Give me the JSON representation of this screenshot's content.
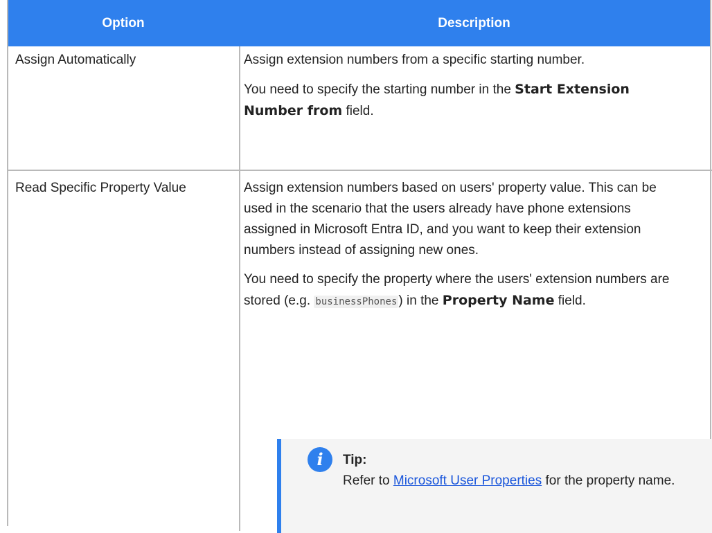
{
  "table": {
    "headers": {
      "option": "Option",
      "description": "Description"
    },
    "rows": [
      {
        "option": "Assign Automatically",
        "description": {
          "p1": "Assign extension numbers from a specific starting number.",
          "p2_before": "You need to specify the starting number in the ",
          "p2_bold": "Start Extension Number from",
          "p2_after": " field."
        }
      },
      {
        "option": "Read Specific Property Value",
        "description": {
          "p1": "Assign extension numbers based on users' property value. This can be used in the scenario that the users already have phone extensions assigned in Microsoft Entra ID, and you want to keep their extension numbers instead of assigning new ones.",
          "p2_before": "You need to specify the property where the users' extension numbers are stored (e.g. ",
          "p2_code": "businessPhones",
          "p2_middle": ") in the ",
          "p2_bold": "Property Name",
          "p2_after": " field."
        }
      }
    ]
  },
  "tip": {
    "icon": "info-icon",
    "icon_glyph": "i",
    "title": "Tip:",
    "before_link": "Refer to ",
    "link": "Microsoft User Properties",
    "after_link": " for the property name.",
    "colors": {
      "accent": "#2f80ed",
      "link": "#1a56db",
      "background": "#f4f4f4"
    }
  },
  "colors": {
    "header_bg": "#2f80ed",
    "header_text": "#ffffff",
    "border": "#b9b9b9"
  }
}
